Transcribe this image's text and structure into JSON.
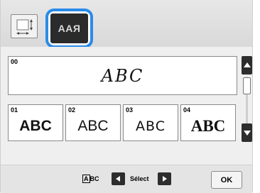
{
  "tabs": {
    "layout_icon": "layout-resize-icon",
    "style_icon_text": "AAЯ"
  },
  "preview": {
    "number": "00",
    "text": "ABC"
  },
  "fonts": [
    {
      "number": "01",
      "sample": "ABC"
    },
    {
      "number": "02",
      "sample": "ABC"
    },
    {
      "number": "03",
      "sample": "ABC"
    },
    {
      "number": "04",
      "sample": "ABC"
    }
  ],
  "bottom": {
    "abc_indicator_boxed": "A",
    "abc_indicator_rest": "BC",
    "select_label": "Sélect",
    "ok_label": "OK"
  },
  "colors": {
    "highlight": "#2a8be8",
    "dark_button": "#2d2d2d"
  }
}
